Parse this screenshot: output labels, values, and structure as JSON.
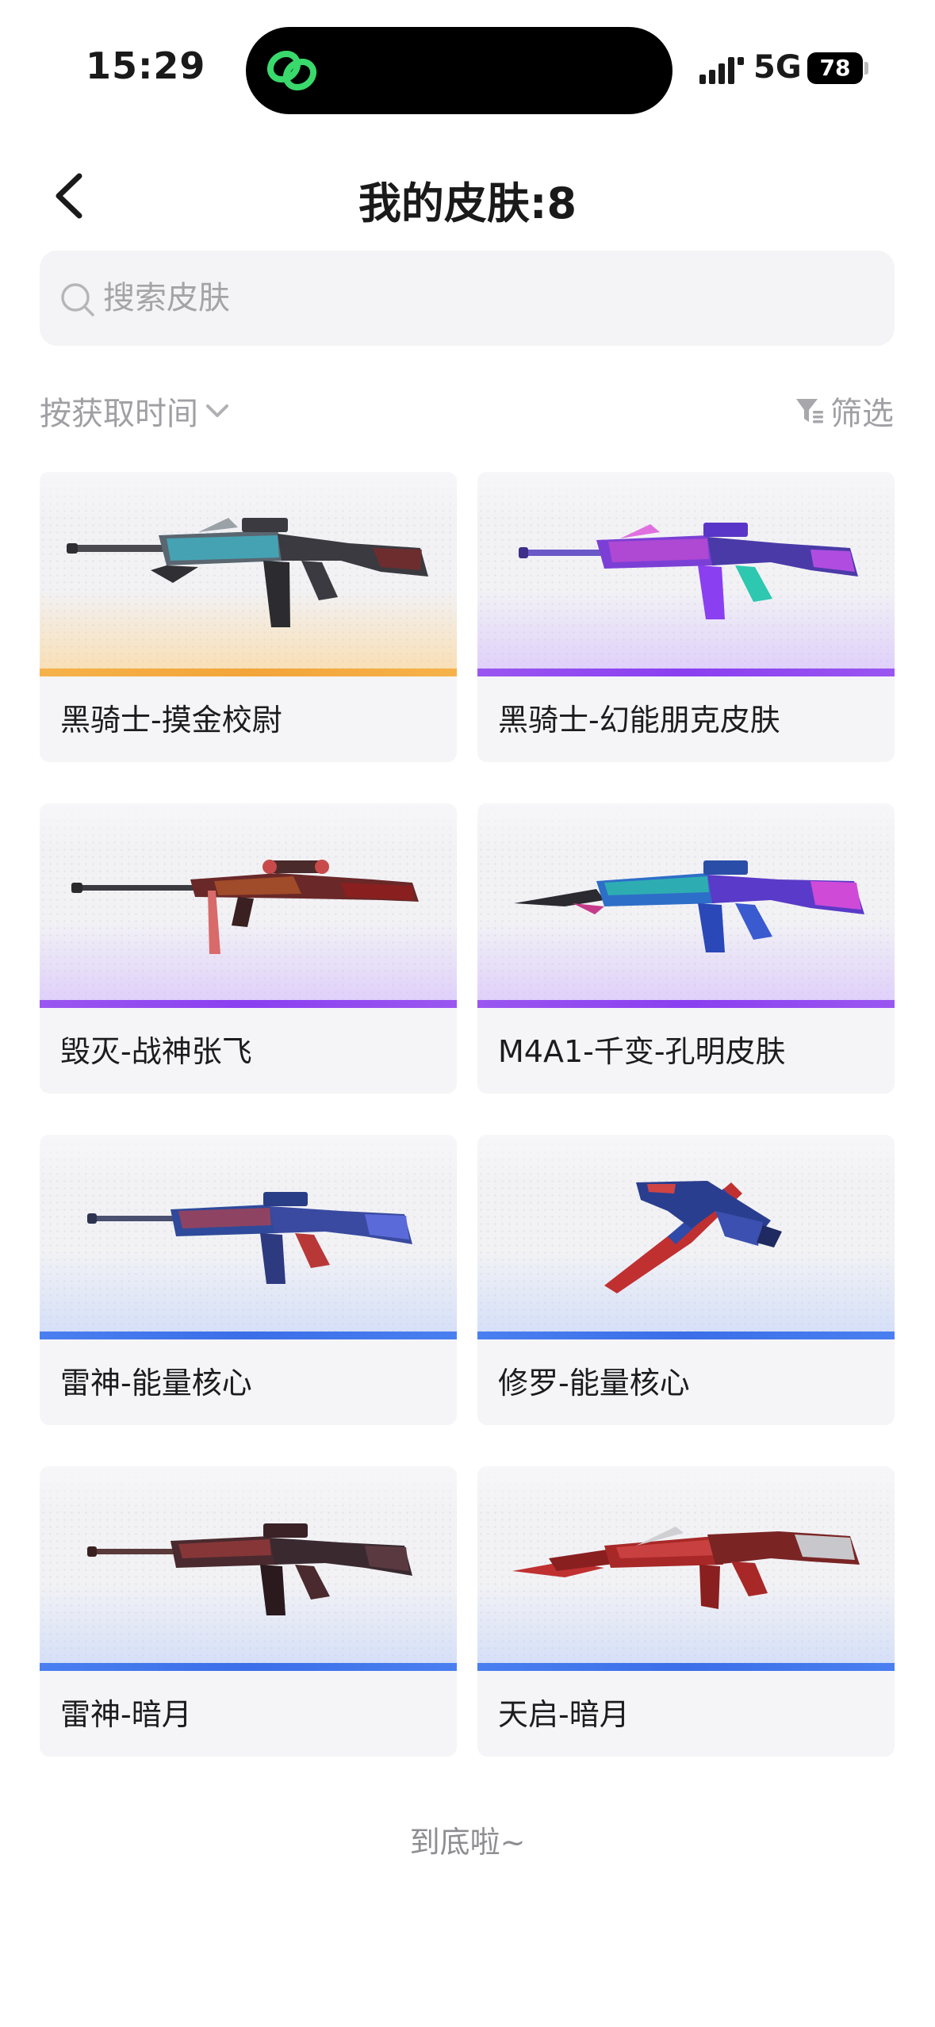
{
  "status_bar": {
    "time": "15:29",
    "network": "5G",
    "battery": "78"
  },
  "header": {
    "title": "我的皮肤:8"
  },
  "search": {
    "placeholder": "搜索皮肤"
  },
  "toolbar": {
    "sort_label": "按获取时间",
    "filter_label": "筛选"
  },
  "skins": [
    {
      "name": "黑骑士-摸金校尉",
      "rarity_color": "#f2a53a"
    },
    {
      "name": "黑骑士-幻能朋克皮肤",
      "rarity_color": "#8a3ff0"
    },
    {
      "name": "毁灭-战神张飞",
      "rarity_color": "#8a3ff0"
    },
    {
      "name": "M4A1-千变-孔明皮肤",
      "rarity_color": "#8a3ff0"
    },
    {
      "name": "雷神-能量核心",
      "rarity_color": "#3b6ee8"
    },
    {
      "name": "修罗-能量核心",
      "rarity_color": "#3b6ee8"
    },
    {
      "name": "雷神-暗月",
      "rarity_color": "#3b6ee8"
    },
    {
      "name": "天启-暗月",
      "rarity_color": "#3b6ee8"
    }
  ],
  "footer": {
    "end_text": "到底啦~"
  }
}
